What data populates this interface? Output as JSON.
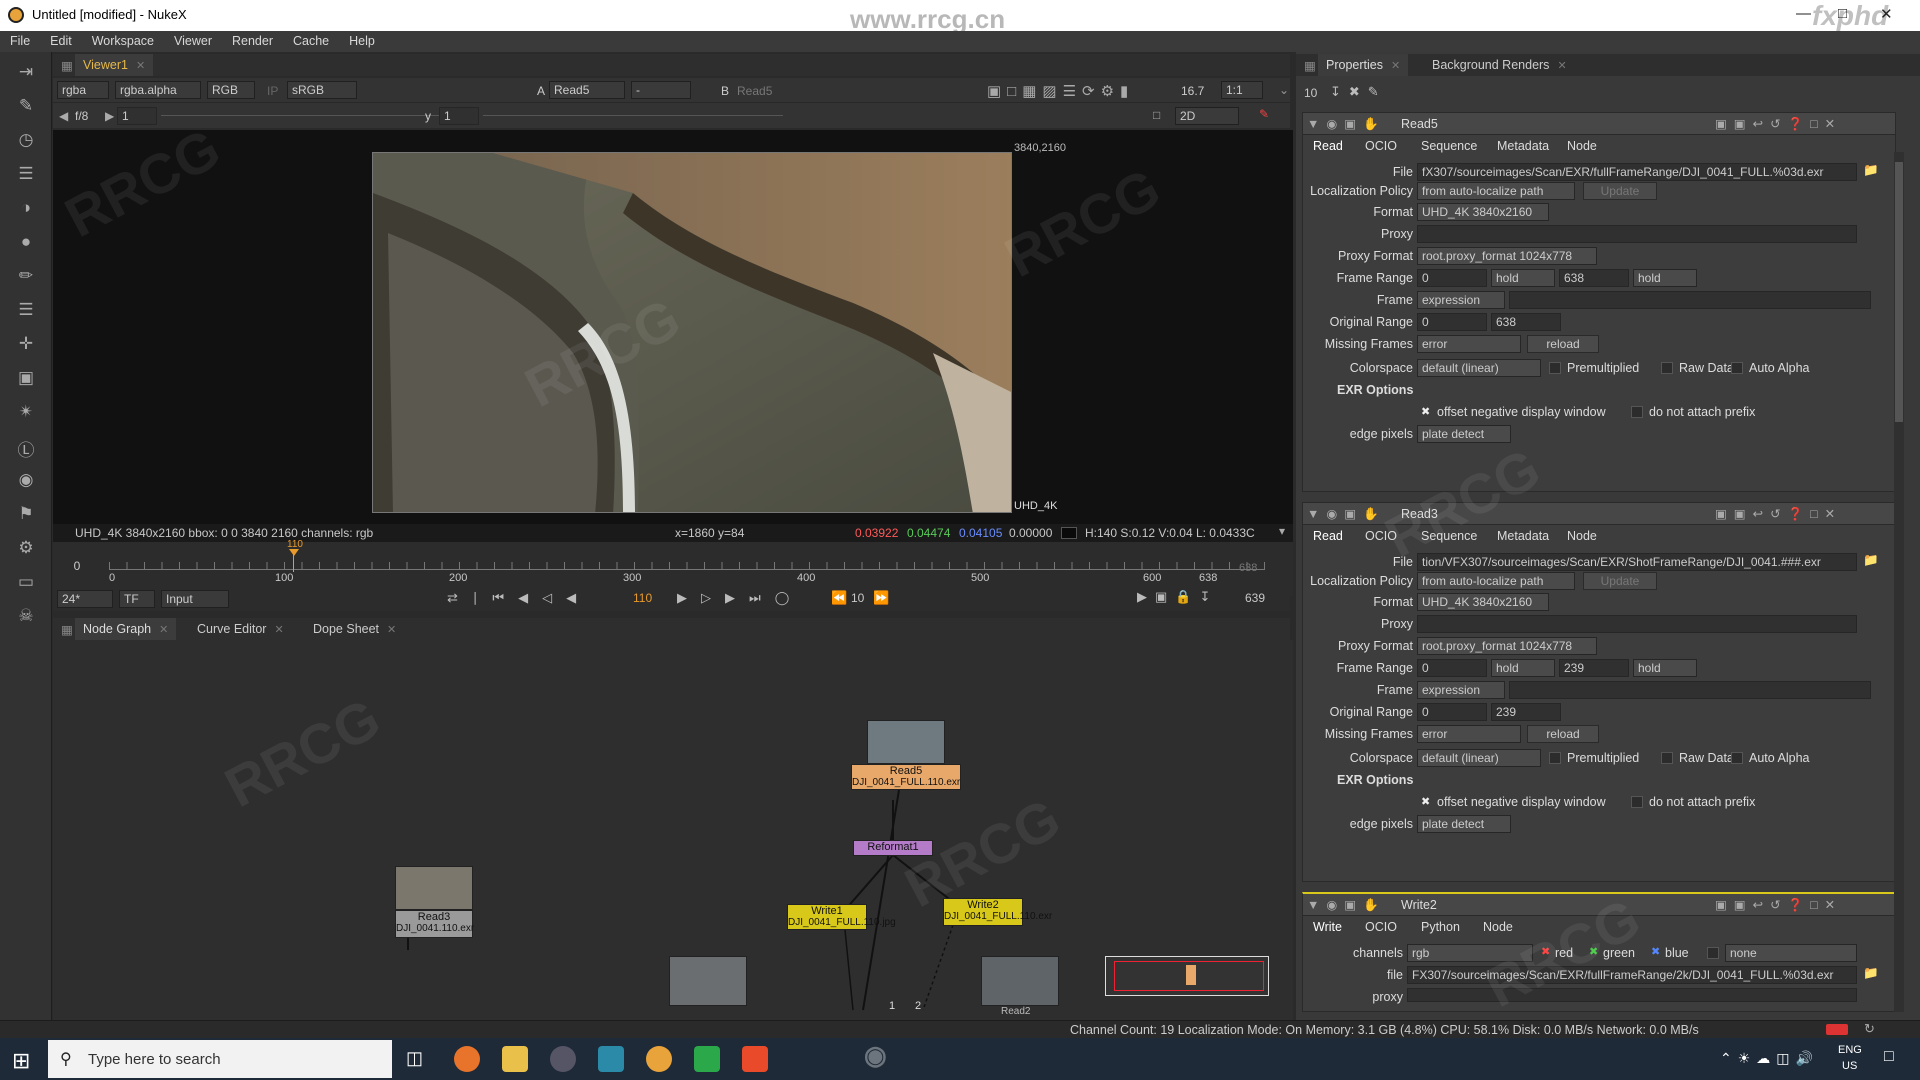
{
  "window": {
    "title": "Untitled [modified] - NukeX",
    "brand": "fxphd",
    "watermark_url": "www.rrcg.cn"
  },
  "menu": [
    "File",
    "Edit",
    "Workspace",
    "Viewer",
    "Render",
    "Cache",
    "Help"
  ],
  "viewer": {
    "tab": "Viewer1",
    "channels": "rgba",
    "alpha": "rgba.alpha",
    "display": "RGB",
    "ip": "IP",
    "colorspace": "sRGB",
    "a_label": "A",
    "a_input": "Read5",
    "dash": "-",
    "b_label": "B",
    "b_input": "Read5",
    "fstop": "f/8",
    "gain": "1",
    "y_label": "y",
    "gamma": "1",
    "zoom": "16.7",
    "ratio": "1:1",
    "mode": "2D",
    "corner": "3840,2160",
    "format_label": "UHD_4K",
    "status_info": "UHD_4K 3840x2160  bbox: 0 0 3840 2160 channels: rgb",
    "coords": "x=1860 y=84",
    "r": "0.03922",
    "g": "0.04474",
    "b": "0.04105",
    "a": "0.00000",
    "hsvl": "H:140 S:0.12 V:0.04  L: 0.0433C"
  },
  "timeline": {
    "start": "0",
    "marks": [
      "0",
      "100",
      "200",
      "300",
      "400",
      "500",
      "600",
      "638"
    ],
    "current": "110",
    "end_label": "638",
    "fps": "24*",
    "tf": "TF",
    "input": "Input",
    "frame_field": "110",
    "step": "10",
    "end_field": "639"
  },
  "graph_tabs": [
    "Node Graph",
    "Curve Editor",
    "Dope Sheet"
  ],
  "nodes": {
    "read5": {
      "name": "Read5",
      "file": "DJI_0041_FULL.110.exr"
    },
    "reformat": {
      "name": "Reformat1"
    },
    "write1": {
      "name": "Write1",
      "file": "DJI_0041_FULL.110.jpg"
    },
    "write2": {
      "name": "Write2",
      "file": "DJI_0041_FULL.110.exr"
    },
    "read3": {
      "name": "Read3",
      "file": "DJI_0041.110.exr"
    },
    "pipe1": "1",
    "pipe2": "2",
    "extra": "Read2"
  },
  "props": {
    "tabs": [
      "Properties",
      "Background Renders"
    ],
    "num": "10",
    "read5": {
      "title": "Read5",
      "subtabs": [
        "Read",
        "OCIO",
        "Sequence",
        "Metadata",
        "Node"
      ],
      "file": "fX307/sourceimages/Scan/EXR/fullFrameRange/DJI_0041_FULL.%03d.exr",
      "localization": "from auto-localize path",
      "update": "Update",
      "format": "UHD_4K 3840x2160",
      "proxy": "",
      "proxy_format": "root.proxy_format 1024x778",
      "fr_start": "0",
      "fr_hold1": "hold",
      "fr_end": "638",
      "fr_hold2": "hold",
      "frame": "expression",
      "orig_start": "0",
      "orig_end": "638",
      "missing": "error",
      "reload": "reload",
      "colorspace": "default (linear)",
      "premult": "Premultiplied",
      "raw": "Raw Data",
      "auto_alpha": "Auto Alpha",
      "exr": "EXR Options",
      "offset": "offset negative display window",
      "noprefix": "do not attach prefix",
      "edge": "plate detect"
    },
    "read3": {
      "title": "Read3",
      "subtabs": [
        "Read",
        "OCIO",
        "Sequence",
        "Metadata",
        "Node"
      ],
      "file": "tion/VFX307/sourceimages/Scan/EXR/ShotFrameRange/DJI_0041.###.exr",
      "localization": "from auto-localize path",
      "update": "Update",
      "format": "UHD_4K 3840x2160",
      "proxy": "",
      "proxy_format": "root.proxy_format 1024x778",
      "fr_start": "0",
      "fr_hold1": "hold",
      "fr_end": "239",
      "fr_hold2": "hold",
      "frame": "expression",
      "orig_start": "0",
      "orig_end": "239",
      "missing": "error",
      "reload": "reload",
      "colorspace": "default (linear)",
      "premult": "Premultiplied",
      "raw": "Raw Data",
      "auto_alpha": "Auto Alpha",
      "exr": "EXR Options",
      "offset": "offset negative display window",
      "noprefix": "do not attach prefix",
      "edge": "plate detect"
    },
    "write2": {
      "title": "Write2",
      "subtabs": [
        "Write",
        "OCIO",
        "Python",
        "Node"
      ],
      "channels": "rgb",
      "red": "red",
      "green": "green",
      "blue": "blue",
      "none": "none",
      "file": "FX307/sourceimages/Scan/EXR/fullFrameRange/2k/DJI_0041_FULL.%03d.exr",
      "proxy_label": "proxy"
    },
    "labels": {
      "file": "File",
      "localization": "Localization Policy",
      "format": "Format",
      "proxy": "Proxy",
      "proxy_format": "Proxy Format",
      "frame_range": "Frame Range",
      "frame": "Frame",
      "orig_range": "Original Range",
      "missing": "Missing Frames",
      "colorspace": "Colorspace",
      "edge": "edge pixels",
      "channels": "channels",
      "file_lc": "file"
    }
  },
  "app_status": "Channel Count: 19 Localization Mode: On Memory: 3.1 GB (4.8%) CPU: 58.1% Disk: 0.0 MB/s Network: 0.0 MB/s",
  "taskbar": {
    "search_placeholder": "Type here to search",
    "lang1": "ENG",
    "lang2": "US"
  }
}
